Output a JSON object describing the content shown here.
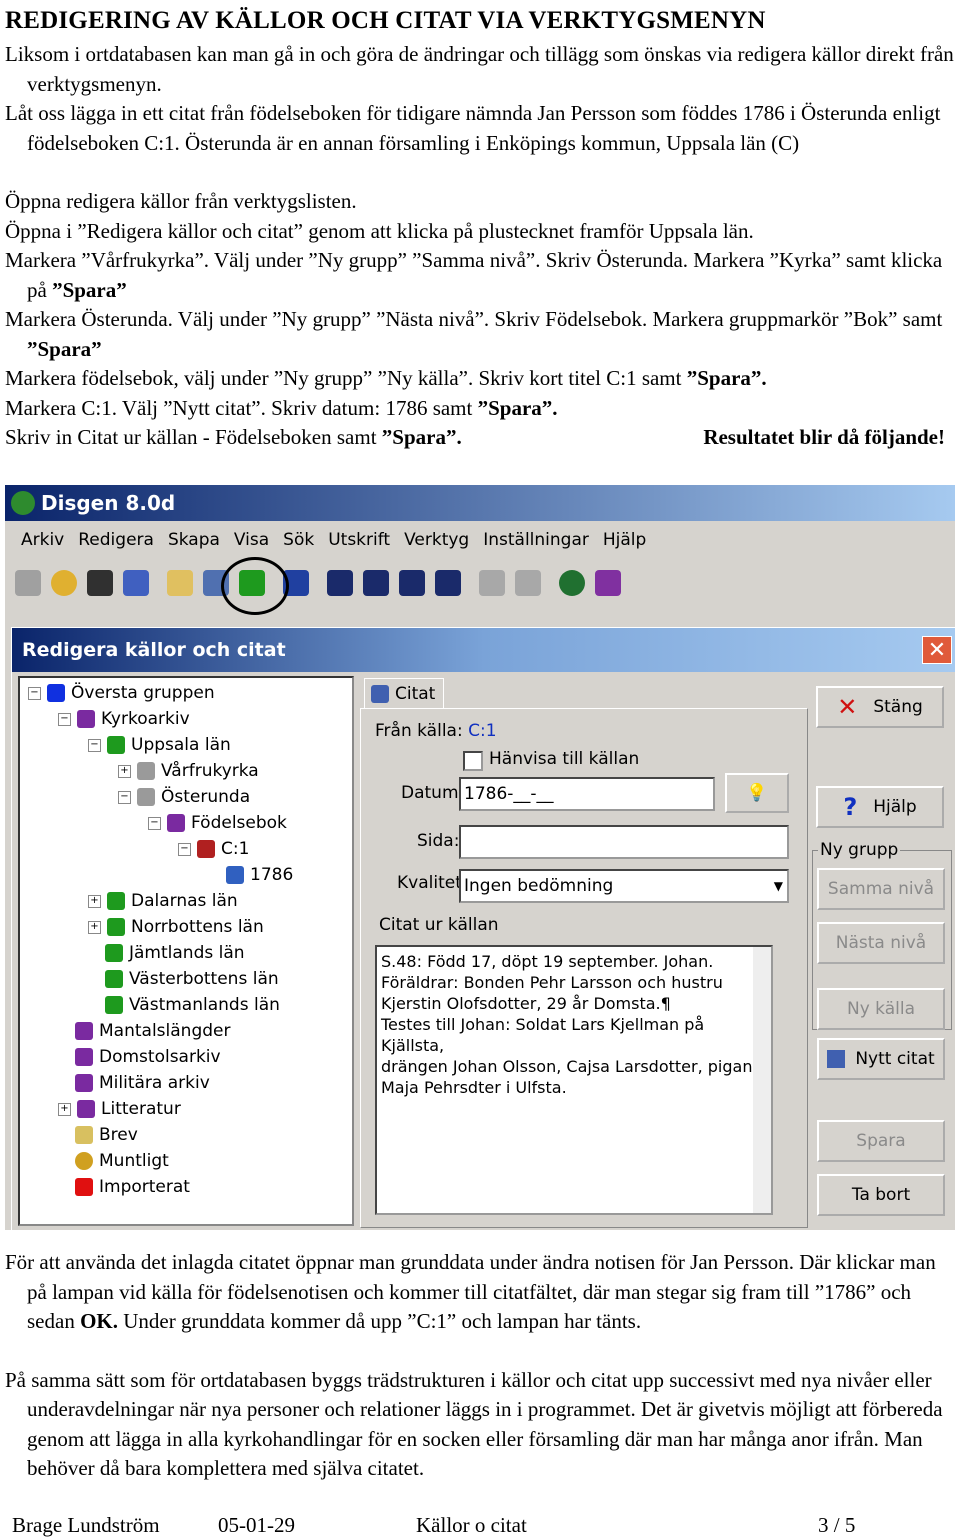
{
  "doc": {
    "heading": "REDIGERING AV KÄLLOR OCH CITAT VIA VERKTYGSMENYN",
    "intro": [
      "Liksom i ortdatabasen kan man gå in och göra de ändringar och tillägg som önskas via redigera källor direkt från verktygsmenyn.",
      "Låt oss lägga in ett citat från födelseboken för tidigare nämnda Jan Persson som föddes 1786 i Österunda enligt födelseboken C:1. Österunda är en annan församling i Enköpings kommun, Uppsala län (C)"
    ],
    "steps": {
      "s1": "Öppna redigera källor från verktygslisten.",
      "s2": "Öppna i ”Redigera källor och citat” genom att klicka på plustecknet framför Uppsala län.",
      "s3a": "Markera ”Vårfrukyrka”. Välj under ”Ny grupp” ”Samma nivå”. Skriv Österunda. Markera ”Kyrka” samt klicka på ",
      "s3b": "”Spara”",
      "s4a": "Markera Österunda. Välj under ”Ny grupp” ”Nästa nivå”. Skriv Födelsebok. Markera gruppmarkör ”Bok” samt ",
      "s4b": "”Spara”",
      "s5a": "Markera födelsebok, välj under ”Ny grupp” ”Ny källa”. Skriv kort titel C:1 samt ",
      "s5b": "”Spara”",
      "s5c": ".",
      "s6a": "Markera C:1. Välj ”Nytt citat”. Skriv datum: 1786 samt ",
      "s6b": "”Spara”",
      "s6c": ".",
      "s7a": "Skriv in Citat ur källan - Födelseboken samt ",
      "s7b": "”Spara”.",
      "s7c": "Resultatet blir då följande!"
    },
    "outro1a": "För att använda det inlagda citatet öppnar man grunddata under ändra notisen för Jan Persson. Där klickar man på lampan vid källa för födelsenotisen och kommer till citatfältet, där man stegar sig fram till ”1786” och sedan ",
    "outro1b": "OK.",
    "outro1c": " Under grunddata kommer då upp ”C:1” och lampan har tänts.",
    "outro2": "På samma sätt som för ortdatabasen byggs trädstrukturen i källor och citat upp successivt med nya nivåer eller underavdelningar när nya personer och relationer läggs in i programmet. Det är givetvis möjligt att förbereda genom att lägga in alla kyrkohandlingar för en socken eller församling där man har många anor ifrån. Man behöver då bara komplettera med själva citatet."
  },
  "app": {
    "title": "Disgen 8.0d",
    "menu": [
      "Arkiv",
      "Redigera",
      "Skapa",
      "Visa",
      "Sök",
      "Utskrift",
      "Verktyg",
      "Inställningar",
      "Hjälp"
    ]
  },
  "dialog": {
    "title": "Redigera källor och citat",
    "close": "✕",
    "tree": [
      {
        "label": "Översta gruppen",
        "exp": "−",
        "color": "#1030e0"
      },
      {
        "label": "Kyrkoarkiv",
        "exp": "−",
        "color": "#7a2aa0"
      },
      {
        "label": "Uppsala län",
        "exp": "−",
        "color": "#1e9a1e"
      },
      {
        "label": "Vårfrukyrka",
        "exp": "+",
        "color": "#9a9a9a"
      },
      {
        "label": "Österunda",
        "exp": "−",
        "color": "#9a9a9a"
      },
      {
        "label": "Födelsebok",
        "exp": "−",
        "color": "#7a2aa0"
      },
      {
        "label": "C:1",
        "exp": "−",
        "color": "#b02020"
      },
      {
        "label": "1786",
        "exp": "",
        "color": "#3060c0"
      },
      {
        "label": "Dalarnas län",
        "exp": "+",
        "color": "#1e9a1e"
      },
      {
        "label": "Norrbottens län",
        "exp": "+",
        "color": "#1e9a1e"
      },
      {
        "label": "Jämtlands län",
        "exp": "",
        "color": "#1e9a1e"
      },
      {
        "label": "Västerbottens län",
        "exp": "",
        "color": "#1e9a1e"
      },
      {
        "label": "Västmanlands län",
        "exp": "",
        "color": "#1e9a1e"
      },
      {
        "label": "Mantalslängder",
        "exp": "",
        "color": "#7a2aa0"
      },
      {
        "label": "Domstolsarkiv",
        "exp": "",
        "color": "#7a2aa0"
      },
      {
        "label": "Militära arkiv",
        "exp": "",
        "color": "#7a2aa0"
      },
      {
        "label": "Litteratur",
        "exp": "+",
        "color": "#7a2aa0"
      },
      {
        "label": "Brev",
        "exp": "",
        "color": "#d8c060"
      },
      {
        "label": "Muntligt",
        "exp": "",
        "color": "#d0a020"
      },
      {
        "label": "Importerat",
        "exp": "",
        "color": "#e01010"
      }
    ],
    "tab": "Citat",
    "from_label": "Från källa:",
    "from_value": "C:1",
    "refer_label": "Hänvisa till källan",
    "date_label": "Datum:",
    "date_value": "1786-__-__",
    "page_label": "Sida:",
    "page_value": "",
    "quality_label": "Kvalitet:",
    "quality_value": "Ingen bedömning",
    "quote_label": "Citat ur källan",
    "quote_lines": [
      "S.48: Född 17, döpt 19 september. Johan.",
      "Föräldrar: Bonden Pehr Larsson och hustru",
      "Kjerstin Olofsdotter, 29 år Domsta.¶",
      "Testes till Johan: Soldat Lars Kjellman på Kjällsta,",
      "drängen Johan Olsson, Cajsa Larsdotter, pigan",
      "Maja Pehrsdter i Ulfsta."
    ],
    "buttons": {
      "close": "Stäng",
      "help": "Hjälp",
      "group": "Ny grupp",
      "same": "Samma nivå",
      "next": "Nästa nivå",
      "new_source": "Ny källa",
      "new_quote": "Nytt citat",
      "save": "Spara",
      "delete": "Ta bort"
    }
  },
  "footer": {
    "author": "Brage Lundström",
    "date": "05-01-29",
    "title": "Källor o citat",
    "page": "3 / 5"
  }
}
